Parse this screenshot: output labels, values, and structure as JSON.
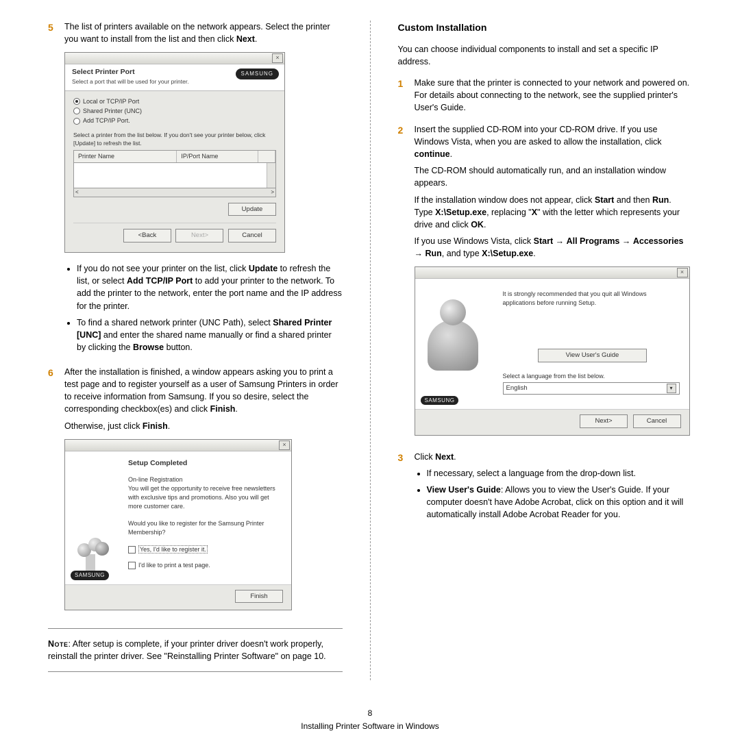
{
  "left": {
    "step5": {
      "num": "5",
      "para": "The list of printers available on the network appears. Select the printer you want to install from the list and then click ",
      "para_bold": "Next",
      "para_end": "."
    },
    "shot1": {
      "title": "Select Printer Port",
      "sub": "Select a port that will be used for your printer.",
      "brand": "SAMSUNG",
      "r1": "Local or TCP/IP Port",
      "r2": "Shared Printer (UNC)",
      "r3": "Add TCP/IP Port.",
      "instr": "Select a printer from the list below. If you don't see your printer below, click [Update] to refresh the list.",
      "col1": "Printer Name",
      "col2": "IP/Port Name",
      "update": "Update",
      "back": "<Back",
      "next": "Next>",
      "cancel": "Cancel"
    },
    "bul1a": "If you do not see your printer on the list, click ",
    "bul1b": "Update",
    "bul1c": " to refresh the list, or select ",
    "bul1d": "Add TCP/IP Port",
    "bul1e": " to add your printer to the network. To add the printer to the network, enter the port name and the IP address for the printer.",
    "bul2a": "To find a shared network printer (UNC Path), select ",
    "bul2b": "Shared Printer [UNC]",
    "bul2c": " and enter the shared name manually or find a shared printer by clicking the ",
    "bul2d": "Browse",
    "bul2e": " button.",
    "step6": {
      "num": "6",
      "p1": "After the installation is finished, a window appears asking you to print a test page and to register yourself as a user of Samsung Printers in order to receive information from Samsung. If you so desire, select the corresponding checkbox(es) and click ",
      "p1b": "Finish",
      "p2a": "Otherwise, just click ",
      "p2b": "Finish",
      "p2c": "."
    },
    "shot2": {
      "h": "Setup Completed",
      "l1": "On-line Registration",
      "l2": "You will get the opportunity to receive free newsletters with exclusive tips and promotions. Also you will get more customer care.",
      "l3": "Would you like to register for the Samsung Printer Membership?",
      "c1": "Yes, I'd like to register it.",
      "c2": "I'd like to print a test page.",
      "brand": "SAMSUNG",
      "finish": "Finish"
    },
    "note_pre": "Note",
    "note_body": ": After setup is complete, if your printer driver doesn't work properly, reinstall the printer driver. See \"Reinstalling Printer Software\" on page 10."
  },
  "right": {
    "heading": "Custom Installation",
    "intro": "You can choose individual components to install and set a specific IP address.",
    "step1": {
      "num": "1",
      "t": "Make sure that the printer is connected to your network and powered on. For details about connecting to the network, see the supplied printer's User's Guide."
    },
    "step2": {
      "num": "2",
      "p1a": "Insert the supplied CD-ROM into your CD-ROM drive. If you use Windows Vista, when you are asked to allow the installation, click ",
      "p1b": "continue",
      "p2": "The CD-ROM should automatically run, and an installation window appears.",
      "p3a": "If the installation window does not appear, click ",
      "p3b": "Start",
      "p3c": " and then ",
      "p3d": "Run",
      "p3e": ". Type ",
      "p3f": "X:\\Setup.exe",
      "p3g": ", replacing \"",
      "p3h": "X",
      "p3i": "\" with the letter which represents your drive and click ",
      "p3j": "OK",
      "p4a": "If you use Windows Vista, click ",
      "p4b": "Start",
      "arr": " → ",
      "p4c": "All Programs",
      "p4d": "Accessories",
      "p4e": "Run",
      "p4f": ", and type ",
      "p4g": "X:\\Setup.exe",
      "p4h": "."
    },
    "shot3": {
      "rec": "It is strongly recommended that you quit all Windows applications before running Setup.",
      "view": "View User's Guide",
      "sel": "Select a language from the list below.",
      "lang": "English",
      "brand": "SAMSUNG",
      "next": "Next>",
      "cancel": "Cancel"
    },
    "step3": {
      "num": "3",
      "t1": "Click ",
      "t1b": "Next",
      "t1c": ".",
      "b1": "If necessary, select a language from the drop-down list.",
      "b2a": "View User's Guide",
      "b2b": ": Allows you to view the User's Guide. If your computer doesn't have Adobe Acrobat, click on this option and it will automatically install Adobe Acrobat Reader for you."
    }
  },
  "footer": {
    "page": "8",
    "title": "Installing Printer Software in Windows"
  }
}
